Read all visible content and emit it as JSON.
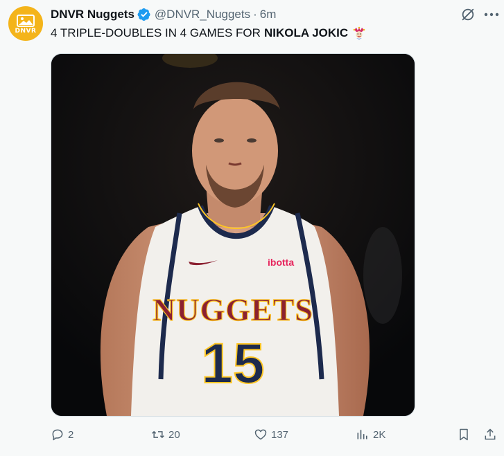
{
  "tweet": {
    "display_name": "DNVR Nuggets",
    "handle": "@DNVR_Nuggets",
    "separator": "·",
    "time": "6m",
    "text_prefix": "4 TRIPLE-DOUBLES IN 4 GAMES FOR",
    "text_bold": "NIKOLA JOKIC",
    "emoji": "joker-emoji"
  },
  "avatar": {
    "label": "DNVR",
    "color": "#f4b41a"
  },
  "media": {
    "jersey_wordmark": "NUGGETS",
    "jersey_number": "15",
    "jersey_sponsor": "ibotta"
  },
  "actions": {
    "replies": "2",
    "reposts": "20",
    "likes": "137",
    "views": "2K"
  },
  "colors": {
    "text": "#0f1419",
    "secondary": "#536471",
    "verified": "#1d9bf0",
    "background": "#f7f9f9"
  },
  "icons": [
    "grok-icon",
    "more-icon",
    "reply-icon",
    "repost-icon",
    "like-icon",
    "views-icon",
    "bookmark-icon",
    "share-icon",
    "verified-badge-icon"
  ]
}
